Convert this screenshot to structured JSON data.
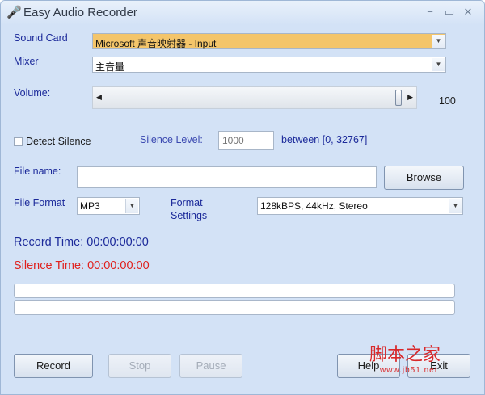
{
  "window": {
    "title": "Easy Audio Recorder"
  },
  "sound_card": {
    "label": "Sound Card",
    "value": "Microsoft 声音映射器 - Input"
  },
  "mixer": {
    "label": "Mixer",
    "value": "主音量"
  },
  "volume": {
    "label": "Volume:",
    "value": 100,
    "display": "100"
  },
  "detect_silence": {
    "label": "Detect Silence",
    "checked": false
  },
  "silence_level": {
    "label": "Silence Level:",
    "placeholder": "1000",
    "range": "between [0, 32767]"
  },
  "file_name": {
    "label": "File name:",
    "value": "",
    "browse_label": "Browse"
  },
  "file_format": {
    "label": "File Format",
    "value": "MP3"
  },
  "format_settings": {
    "label_line1": "Format",
    "label_line2": "Settings",
    "value": "128kBPS, 44kHz, Stereo"
  },
  "record_time": {
    "label": "Record Time: 00:00:00:00",
    "color": "#1c2a9a"
  },
  "silence_time": {
    "label": "Silence Time: 00:00:00:00",
    "color": "#e0221f"
  },
  "buttons": {
    "record": "Record",
    "stop": "Stop",
    "pause": "Pause",
    "help": "Help",
    "exit": "Exit"
  },
  "watermark": {
    "text": "脚本之家",
    "url": "www.jb51.net"
  }
}
